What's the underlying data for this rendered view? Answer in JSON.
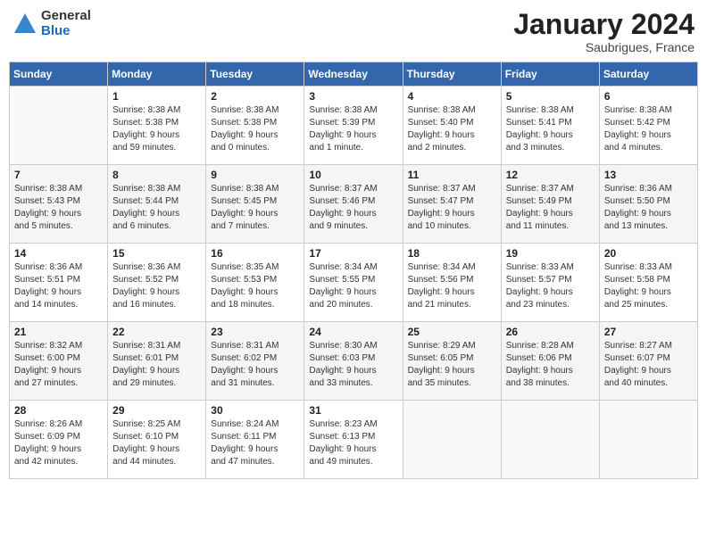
{
  "header": {
    "logo_general": "General",
    "logo_blue": "Blue",
    "month_title": "January 2024",
    "location": "Saubrigues, France"
  },
  "days_of_week": [
    "Sunday",
    "Monday",
    "Tuesday",
    "Wednesday",
    "Thursday",
    "Friday",
    "Saturday"
  ],
  "weeks": [
    {
      "cells": [
        {
          "day": "",
          "info": ""
        },
        {
          "day": "1",
          "info": "Sunrise: 8:38 AM\nSunset: 5:38 PM\nDaylight: 9 hours\nand 59 minutes."
        },
        {
          "day": "2",
          "info": "Sunrise: 8:38 AM\nSunset: 5:38 PM\nDaylight: 9 hours\nand 0 minutes."
        },
        {
          "day": "3",
          "info": "Sunrise: 8:38 AM\nSunset: 5:39 PM\nDaylight: 9 hours\nand 1 minute."
        },
        {
          "day": "4",
          "info": "Sunrise: 8:38 AM\nSunset: 5:40 PM\nDaylight: 9 hours\nand 2 minutes."
        },
        {
          "day": "5",
          "info": "Sunrise: 8:38 AM\nSunset: 5:41 PM\nDaylight: 9 hours\nand 3 minutes."
        },
        {
          "day": "6",
          "info": "Sunrise: 8:38 AM\nSunset: 5:42 PM\nDaylight: 9 hours\nand 4 minutes."
        }
      ]
    },
    {
      "cells": [
        {
          "day": "7",
          "info": "Sunrise: 8:38 AM\nSunset: 5:43 PM\nDaylight: 9 hours\nand 5 minutes."
        },
        {
          "day": "8",
          "info": "Sunrise: 8:38 AM\nSunset: 5:44 PM\nDaylight: 9 hours\nand 6 minutes."
        },
        {
          "day": "9",
          "info": "Sunrise: 8:38 AM\nSunset: 5:45 PM\nDaylight: 9 hours\nand 7 minutes."
        },
        {
          "day": "10",
          "info": "Sunrise: 8:37 AM\nSunset: 5:46 PM\nDaylight: 9 hours\nand 9 minutes."
        },
        {
          "day": "11",
          "info": "Sunrise: 8:37 AM\nSunset: 5:47 PM\nDaylight: 9 hours\nand 10 minutes."
        },
        {
          "day": "12",
          "info": "Sunrise: 8:37 AM\nSunset: 5:49 PM\nDaylight: 9 hours\nand 11 minutes."
        },
        {
          "day": "13",
          "info": "Sunrise: 8:36 AM\nSunset: 5:50 PM\nDaylight: 9 hours\nand 13 minutes."
        }
      ]
    },
    {
      "cells": [
        {
          "day": "14",
          "info": "Sunrise: 8:36 AM\nSunset: 5:51 PM\nDaylight: 9 hours\nand 14 minutes."
        },
        {
          "day": "15",
          "info": "Sunrise: 8:36 AM\nSunset: 5:52 PM\nDaylight: 9 hours\nand 16 minutes."
        },
        {
          "day": "16",
          "info": "Sunrise: 8:35 AM\nSunset: 5:53 PM\nDaylight: 9 hours\nand 18 minutes."
        },
        {
          "day": "17",
          "info": "Sunrise: 8:34 AM\nSunset: 5:55 PM\nDaylight: 9 hours\nand 20 minutes."
        },
        {
          "day": "18",
          "info": "Sunrise: 8:34 AM\nSunset: 5:56 PM\nDaylight: 9 hours\nand 21 minutes."
        },
        {
          "day": "19",
          "info": "Sunrise: 8:33 AM\nSunset: 5:57 PM\nDaylight: 9 hours\nand 23 minutes."
        },
        {
          "day": "20",
          "info": "Sunrise: 8:33 AM\nSunset: 5:58 PM\nDaylight: 9 hours\nand 25 minutes."
        }
      ]
    },
    {
      "cells": [
        {
          "day": "21",
          "info": "Sunrise: 8:32 AM\nSunset: 6:00 PM\nDaylight: 9 hours\nand 27 minutes."
        },
        {
          "day": "22",
          "info": "Sunrise: 8:31 AM\nSunset: 6:01 PM\nDaylight: 9 hours\nand 29 minutes."
        },
        {
          "day": "23",
          "info": "Sunrise: 8:31 AM\nSunset: 6:02 PM\nDaylight: 9 hours\nand 31 minutes."
        },
        {
          "day": "24",
          "info": "Sunrise: 8:30 AM\nSunset: 6:03 PM\nDaylight: 9 hours\nand 33 minutes."
        },
        {
          "day": "25",
          "info": "Sunrise: 8:29 AM\nSunset: 6:05 PM\nDaylight: 9 hours\nand 35 minutes."
        },
        {
          "day": "26",
          "info": "Sunrise: 8:28 AM\nSunset: 6:06 PM\nDaylight: 9 hours\nand 38 minutes."
        },
        {
          "day": "27",
          "info": "Sunrise: 8:27 AM\nSunset: 6:07 PM\nDaylight: 9 hours\nand 40 minutes."
        }
      ]
    },
    {
      "cells": [
        {
          "day": "28",
          "info": "Sunrise: 8:26 AM\nSunset: 6:09 PM\nDaylight: 9 hours\nand 42 minutes."
        },
        {
          "day": "29",
          "info": "Sunrise: 8:25 AM\nSunset: 6:10 PM\nDaylight: 9 hours\nand 44 minutes."
        },
        {
          "day": "30",
          "info": "Sunrise: 8:24 AM\nSunset: 6:11 PM\nDaylight: 9 hours\nand 47 minutes."
        },
        {
          "day": "31",
          "info": "Sunrise: 8:23 AM\nSunset: 6:13 PM\nDaylight: 9 hours\nand 49 minutes."
        },
        {
          "day": "",
          "info": ""
        },
        {
          "day": "",
          "info": ""
        },
        {
          "day": "",
          "info": ""
        }
      ]
    }
  ]
}
